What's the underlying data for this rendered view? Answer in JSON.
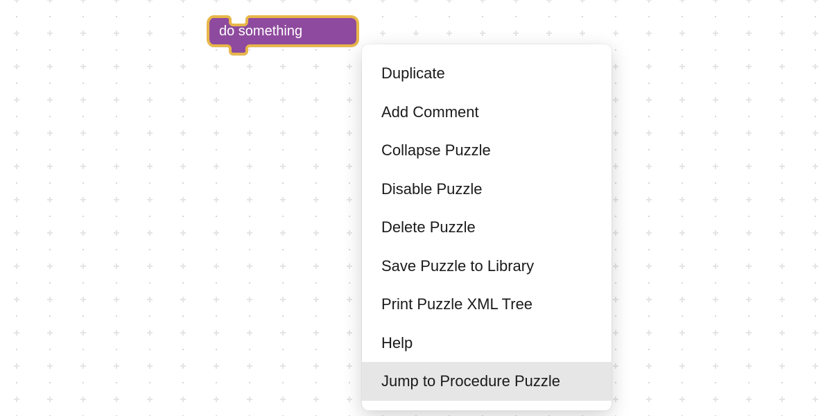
{
  "block": {
    "label": "do something",
    "fill": "#8e4a9e",
    "stroke": "#e7b74a"
  },
  "menu": {
    "items": [
      {
        "label": "Duplicate",
        "highlight": false
      },
      {
        "label": "Add Comment",
        "highlight": false
      },
      {
        "label": "Collapse Puzzle",
        "highlight": false
      },
      {
        "label": "Disable Puzzle",
        "highlight": false
      },
      {
        "label": "Delete Puzzle",
        "highlight": false
      },
      {
        "label": "Save Puzzle to Library",
        "highlight": false
      },
      {
        "label": "Print Puzzle XML Tree",
        "highlight": false
      },
      {
        "label": "Help",
        "highlight": false
      },
      {
        "label": "Jump to Procedure Puzzle",
        "highlight": true
      }
    ]
  }
}
